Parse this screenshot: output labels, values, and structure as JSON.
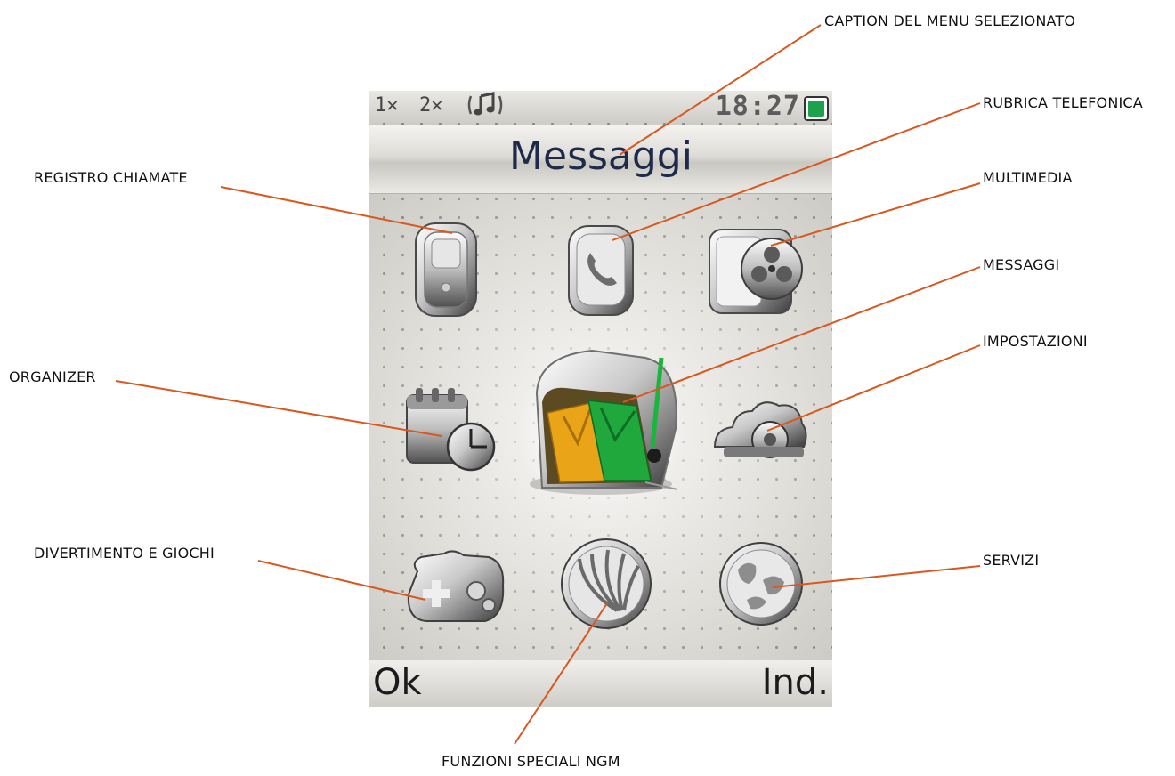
{
  "screen": {
    "status": {
      "sim1": "1✕",
      "sim2": "2✕",
      "profile_icon": "music-note-icon",
      "time": "18:27",
      "battery_icon": "battery-icon",
      "battery_color": "#1aa34a"
    },
    "caption": "Messaggi",
    "icons": [
      {
        "id": "registro-chiamate",
        "icon": "phone-device-icon"
      },
      {
        "id": "rubrica-telefonica",
        "icon": "handset-icon"
      },
      {
        "id": "multimedia",
        "icon": "film-reel-icon"
      },
      {
        "id": "organizer",
        "icon": "calendar-clock-icon"
      },
      {
        "id": "messaggi",
        "icon": "mailbox-icon",
        "selected": true
      },
      {
        "id": "impostazioni",
        "icon": "gear-icon"
      },
      {
        "id": "divertimento-e-giochi",
        "icon": "gamepad-icon"
      },
      {
        "id": "funzioni-speciali-ngm",
        "icon": "shell-icon"
      },
      {
        "id": "servizi",
        "icon": "globe-icon"
      }
    ],
    "softkeys": {
      "left": "Ok",
      "right": "Ind."
    }
  },
  "callouts": {
    "caption_del_menu_selezionato": "CAPTION DEL MENU SELEZIONATO",
    "rubrica_telefonica": "RUBRICA TELEFONICA",
    "registro_chiamate": "REGISTRO CHIAMATE",
    "multimedia": "MULTIMEDIA",
    "messaggi": "MESSAGGI",
    "organizer": "ORGANIZER",
    "impostazioni": "IMPOSTAZIONI",
    "divertimento_e_giochi": "DIVERTIMENTO E GIOCHI",
    "servizi": "SERVIZI",
    "funzioni_speciali_ngm": "FUNZIONI SPECIALI NGM"
  },
  "colors": {
    "leader_line": "#d9581f",
    "caption_text": "#1e2a4a"
  }
}
